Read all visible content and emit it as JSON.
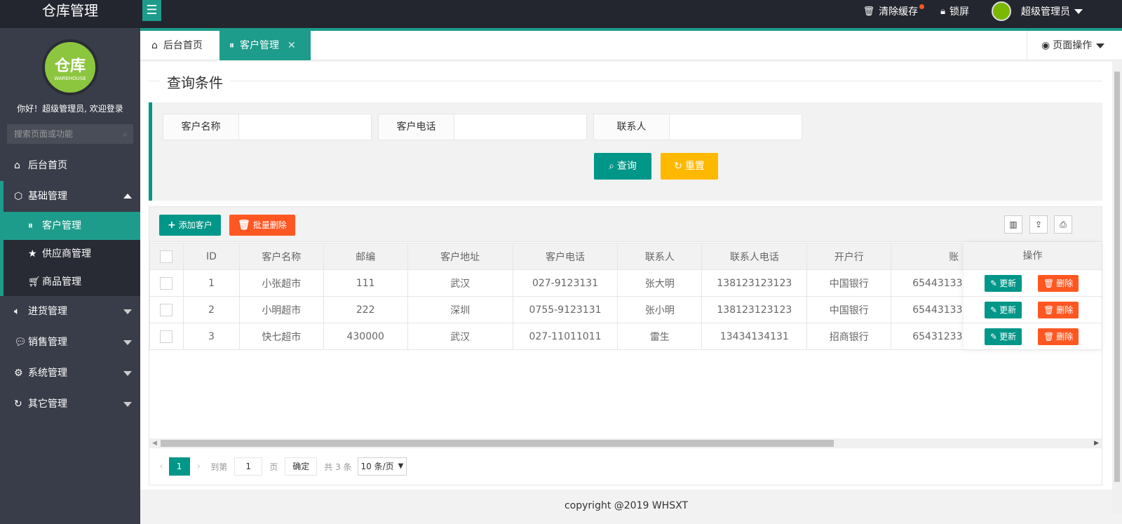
{
  "header": {
    "app_title": "仓库管理",
    "menu_icon": "hamburger-icon",
    "clear_cache": "清除缓存",
    "lock_screen": "锁屏",
    "user_name": "超级管理员"
  },
  "sidebar": {
    "avatar_big": "仓库",
    "avatar_small": "WAREHOUSE",
    "welcome": "你好！超级管理员, 欢迎登录",
    "search_placeholder": "搜索页面或功能",
    "items": [
      {
        "label": "后台首页",
        "icon": "home-icon"
      },
      {
        "label": "基础管理",
        "icon": "cube-icon"
      },
      {
        "label": "客户管理",
        "icon": "pause-circle-icon"
      },
      {
        "label": "供应商管理",
        "icon": "star-icon"
      },
      {
        "label": "商品管理",
        "icon": "cart-icon"
      },
      {
        "label": "进货管理",
        "icon": "speaker-icon"
      },
      {
        "label": "销售管理",
        "icon": "chat-icon"
      },
      {
        "label": "系统管理",
        "icon": "gear-icon"
      },
      {
        "label": "其它管理",
        "icon": "refresh-icon"
      }
    ]
  },
  "tabs": [
    {
      "label": "后台首页"
    },
    {
      "label": "客户管理"
    }
  ],
  "page_op": "页面操作",
  "query": {
    "legend": "查询条件",
    "fields": [
      {
        "label": "客户名称",
        "value": ""
      },
      {
        "label": "客户电话",
        "value": ""
      },
      {
        "label": "联系人",
        "value": ""
      }
    ],
    "search_btn": "查询",
    "reset_btn": "重置"
  },
  "toolbar": {
    "add_btn": "添加客户",
    "batch_delete_btn": "批量删除"
  },
  "table": {
    "columns": [
      "ID",
      "客户名称",
      "邮编",
      "客户地址",
      "客户电话",
      "联系人",
      "联系人电话",
      "开户行",
      "账"
    ],
    "op_header": "操作",
    "update_label": "更新",
    "delete_label": "删除",
    "rows": [
      [
        "1",
        "小张超市",
        "111",
        "武汉",
        "027-9123131",
        "张大明",
        "138123123123",
        "中国银行",
        "65443133"
      ],
      [
        "2",
        "小明超市",
        "222",
        "深圳",
        "0755-9123131",
        "张小明",
        "138123123123",
        "中国银行",
        "65443133"
      ],
      [
        "3",
        "快七超市",
        "430000",
        "武汉",
        "027-11011011",
        "雷生",
        "13434134131",
        "招商银行",
        "65431233"
      ]
    ]
  },
  "pager": {
    "current": "1",
    "goto_label": "到第",
    "goto_value": "1",
    "page_unit": "页",
    "confirm": "确定",
    "total": "共 3 条",
    "page_size": "10 条/页"
  },
  "footer": "copyright @2019 WHSXT"
}
